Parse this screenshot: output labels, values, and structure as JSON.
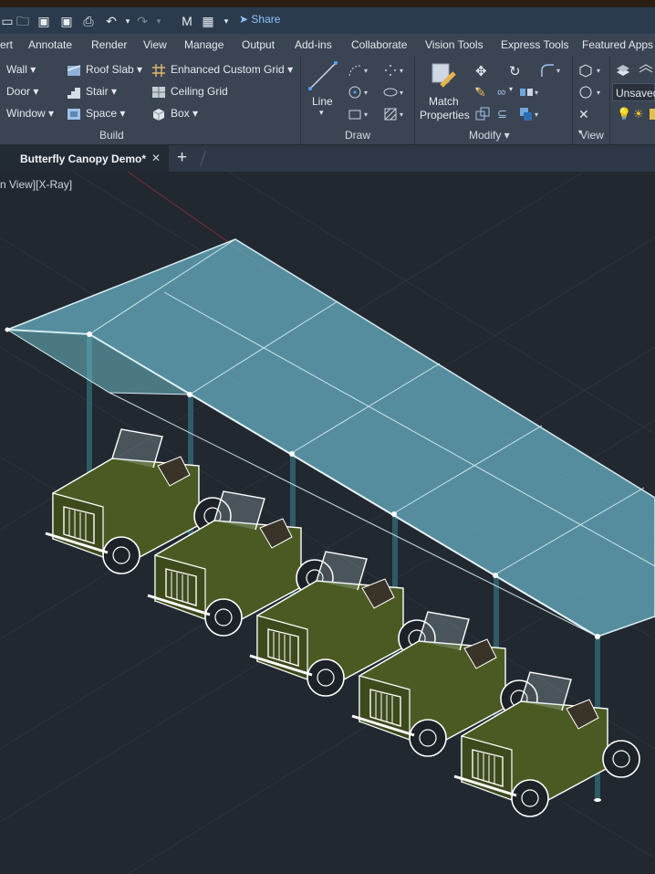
{
  "quick_access": {
    "icons": [
      "open-icon",
      "save-icon",
      "save-as-icon",
      "print-icon",
      "undo-icon",
      "redo-icon",
      "sign-in-icon",
      "workspace-icon"
    ],
    "share_label": "Share"
  },
  "menu": {
    "tabs": [
      "ert",
      "Annotate",
      "Render",
      "View",
      "Manage",
      "Output",
      "Add-ins",
      "Collaborate",
      "Vision Tools",
      "Express Tools",
      "Featured Apps"
    ]
  },
  "ribbon": {
    "build": {
      "items": [
        "Wall",
        "Door",
        "Window",
        "Roof Slab",
        "Stair",
        "Space",
        "Enhanced Custom Grid",
        "Ceiling Grid",
        "Box"
      ],
      "title": "Build"
    },
    "draw": {
      "line_label": "Line",
      "title": "Draw"
    },
    "modify": {
      "match_line1": "Match",
      "match_line2": "Properties",
      "title": "Modify"
    },
    "view": {
      "title": "View",
      "unsaved_label": "Unsaved"
    }
  },
  "document": {
    "tab_title": "Butterfly Canopy Demo*",
    "close_symbol": "✕",
    "new_tab_symbol": "+"
  },
  "viewport": {
    "label": "n View][X-Ray]"
  },
  "scene": {
    "canopy_color": "#4f8a9c",
    "jeep_color": "#4a5a22",
    "post_color": "#2e5b66",
    "vehicle_count": 5
  }
}
